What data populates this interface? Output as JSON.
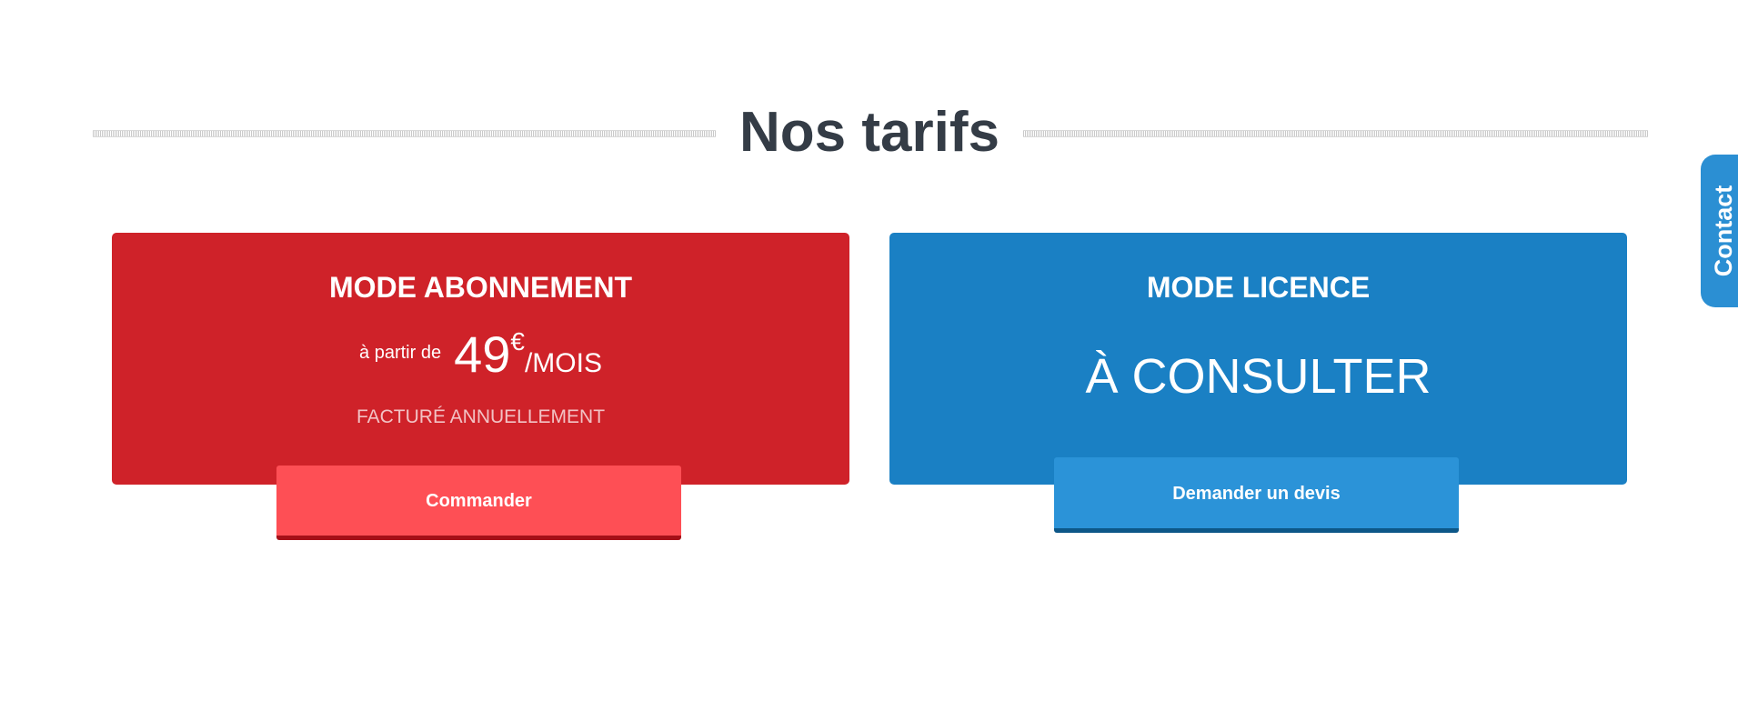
{
  "header": {
    "title": "Nos tarifs"
  },
  "plans": {
    "subscription": {
      "title": "MODE ABONNEMENT",
      "price_prefix": "à partir de",
      "price_amount": "49",
      "price_currency": "€",
      "price_period": "/MOIS",
      "billing_note": "FACTURÉ ANNUELLEMENT",
      "button_label": "Commander",
      "color": "#cf2229",
      "button_color": "#fe4f55"
    },
    "license": {
      "title": "MODE LICENCE",
      "price_text": "À CONSULTER",
      "button_label": "Demander un devis",
      "color": "#1a80c4",
      "button_color": "#2b93d8"
    }
  },
  "contact_tab": {
    "label": "Contact",
    "color": "#2b8fd3"
  }
}
